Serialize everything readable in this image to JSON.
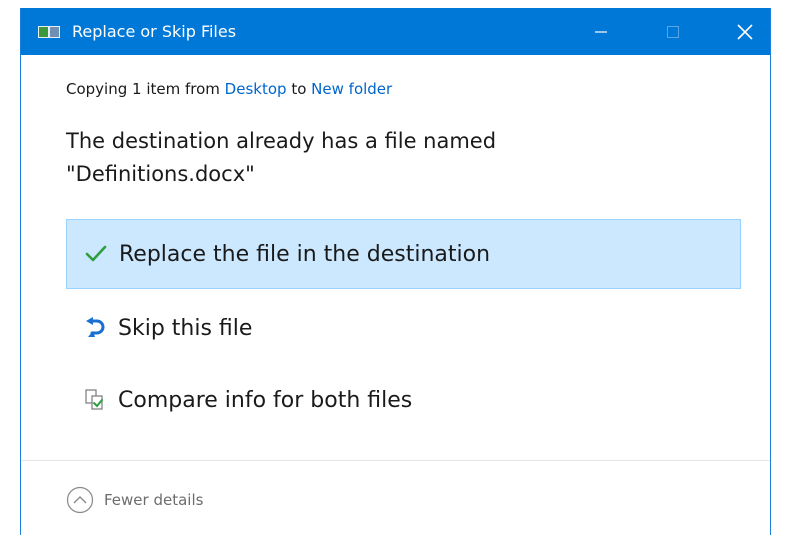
{
  "window": {
    "title": "Replace or Skip Files",
    "accent_color": "#0078d7"
  },
  "copying": {
    "prefix": "Copying 1 item from",
    "source": "Desktop",
    "connector": "to",
    "destination": "New folder"
  },
  "message": {
    "line1": "The destination already has a file named",
    "line2": "\"Definitions.docx\""
  },
  "options": [
    {
      "label": "Replace the file in the destination",
      "icon": "check-icon",
      "selected": true
    },
    {
      "label": "Skip this file",
      "icon": "skip-arrow-icon",
      "selected": false
    },
    {
      "label": "Compare info for both files",
      "icon": "compare-files-icon",
      "selected": false
    }
  ],
  "footer": {
    "details_label": "Fewer details",
    "icon": "chevron-up-circle-icon"
  }
}
